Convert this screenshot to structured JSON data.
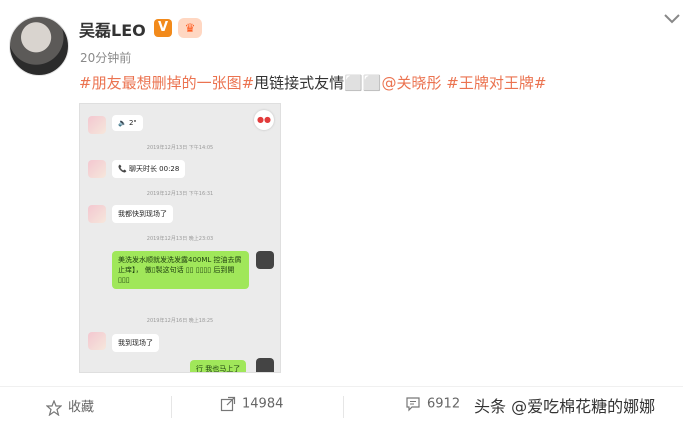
{
  "post": {
    "username": "吴磊LEO",
    "verified_badge": "V",
    "member_badge": "♛",
    "time": "20分钟前",
    "text_parts": [
      {
        "text": "#朋友最想删掉的一张图#",
        "style": "tag"
      },
      {
        "text": "甩链接式友情⬜⬜",
        "style": "plain"
      },
      {
        "text": "@关晓彤",
        "style": "tag"
      },
      {
        "text": " #王牌对王牌#",
        "style": "tag"
      }
    ]
  },
  "chat": {
    "messages": [
      {
        "text": "🔈 2\""
      },
      {
        "stamp": "2019年12月13日 下午14:05"
      },
      {
        "text": "📞 聊天时长 00:28"
      },
      {
        "stamp": "2019年12月13日 下午16:31"
      },
      {
        "text": "我都快到现场了"
      },
      {
        "stamp": "2019年12月13日 晚上23:03"
      },
      {
        "text": "美洗发水顺就发洗发露400ML 控油去屑止痒】，  傲▯製这句话 ▯▯ ▯▯▯▯ 后到開▯▯▯"
      },
      {
        "stamp": "2019年12月16日 晚上18:25"
      },
      {
        "text": "我到现场了"
      },
      {
        "text": "行 我也马上了"
      }
    ]
  },
  "actions": {
    "favorite_label": "收藏",
    "share_count": "14984",
    "comment_count": "6912"
  },
  "watermark": "头条 @爱吃棉花糖的娜娜",
  "colors": {
    "tag": "#eb7350",
    "badge": "#f28a1b"
  },
  "icons": [
    "star-icon",
    "share-icon",
    "comment-icon",
    "chevron-down-icon"
  ]
}
